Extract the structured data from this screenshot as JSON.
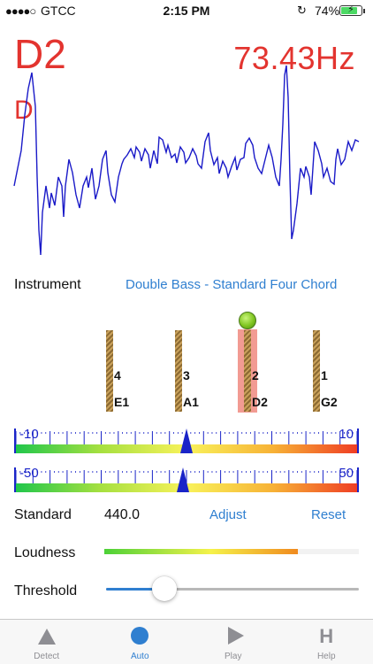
{
  "status_bar": {
    "signal": "●●●●○",
    "carrier": "GTCC",
    "time": "2:15 PM",
    "battery_percent": "74%",
    "battery_level": 0.74
  },
  "readout": {
    "note": "D2",
    "note_name": "D",
    "frequency": "73.43",
    "frequency_unit": "Hz"
  },
  "instrument": {
    "label": "Instrument",
    "value": "Double Bass - Standard Four Chord"
  },
  "strings": [
    {
      "number": "4",
      "note": "E1",
      "active": false
    },
    {
      "number": "3",
      "note": "A1",
      "active": false
    },
    {
      "number": "2",
      "note": "D2",
      "active": true
    },
    {
      "number": "1",
      "note": "G2",
      "active": false
    }
  ],
  "meters": [
    {
      "min_label": "-10",
      "max_label": "10",
      "min": -10,
      "max": 10,
      "value": 0
    },
    {
      "min_label": "-50",
      "max_label": "50",
      "min": -50,
      "max": 50,
      "value": -1
    }
  ],
  "standard": {
    "label": "Standard",
    "value": "440.0",
    "adjust_label": "Adjust",
    "reset_label": "Reset"
  },
  "loudness": {
    "label": "Loudness",
    "level": 0.76
  },
  "threshold": {
    "label": "Threshold",
    "level": 0.23
  },
  "tabs": [
    {
      "label": "Detect",
      "icon": "triangle-up-icon",
      "active": false
    },
    {
      "label": "Auto",
      "icon": "circle-icon",
      "active": true
    },
    {
      "label": "Play",
      "icon": "play-icon",
      "active": false
    },
    {
      "label": "Help",
      "icon": "help-h-icon",
      "active": false
    }
  ],
  "colors": {
    "accent": "#2f7fd0",
    "readout": "#e3342f",
    "waveform": "#1a1ac8",
    "meter_marker": "#1a24c8"
  }
}
